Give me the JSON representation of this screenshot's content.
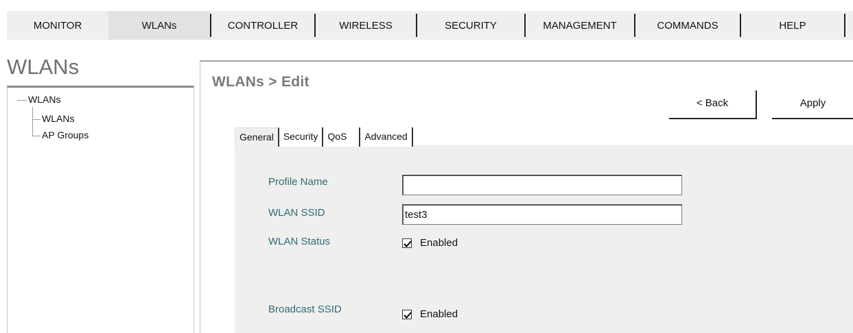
{
  "top_menu": {
    "items": [
      {
        "label": "MONITOR"
      },
      {
        "label": "WLANs"
      },
      {
        "label": "CONTROLLER"
      },
      {
        "label": "WIRELESS"
      },
      {
        "label": "SECURITY"
      },
      {
        "label": "MANAGEMENT"
      },
      {
        "label": "COMMANDS"
      },
      {
        "label": "HELP"
      }
    ]
  },
  "page_title": "WLANs",
  "tree": {
    "root": "WLANs",
    "children": [
      "WLANs",
      "AP Groups"
    ]
  },
  "main": {
    "title": "WLANs > Edit",
    "back_label": "< Back",
    "apply_label": "Apply",
    "tabs": [
      "General",
      "Security",
      "QoS",
      "Advanced"
    ],
    "active_tab": "General",
    "fields": {
      "profile_name": {
        "label": "Profile Name",
        "value": ""
      },
      "wlan_ssid": {
        "label": "WLAN SSID",
        "value": "test3"
      },
      "wlan_status": {
        "label": "WLAN Status",
        "checked": true,
        "option": "Enabled"
      },
      "broadcast_ssid": {
        "label": "Broadcast SSID",
        "checked": true,
        "option": "Enabled"
      }
    }
  }
}
